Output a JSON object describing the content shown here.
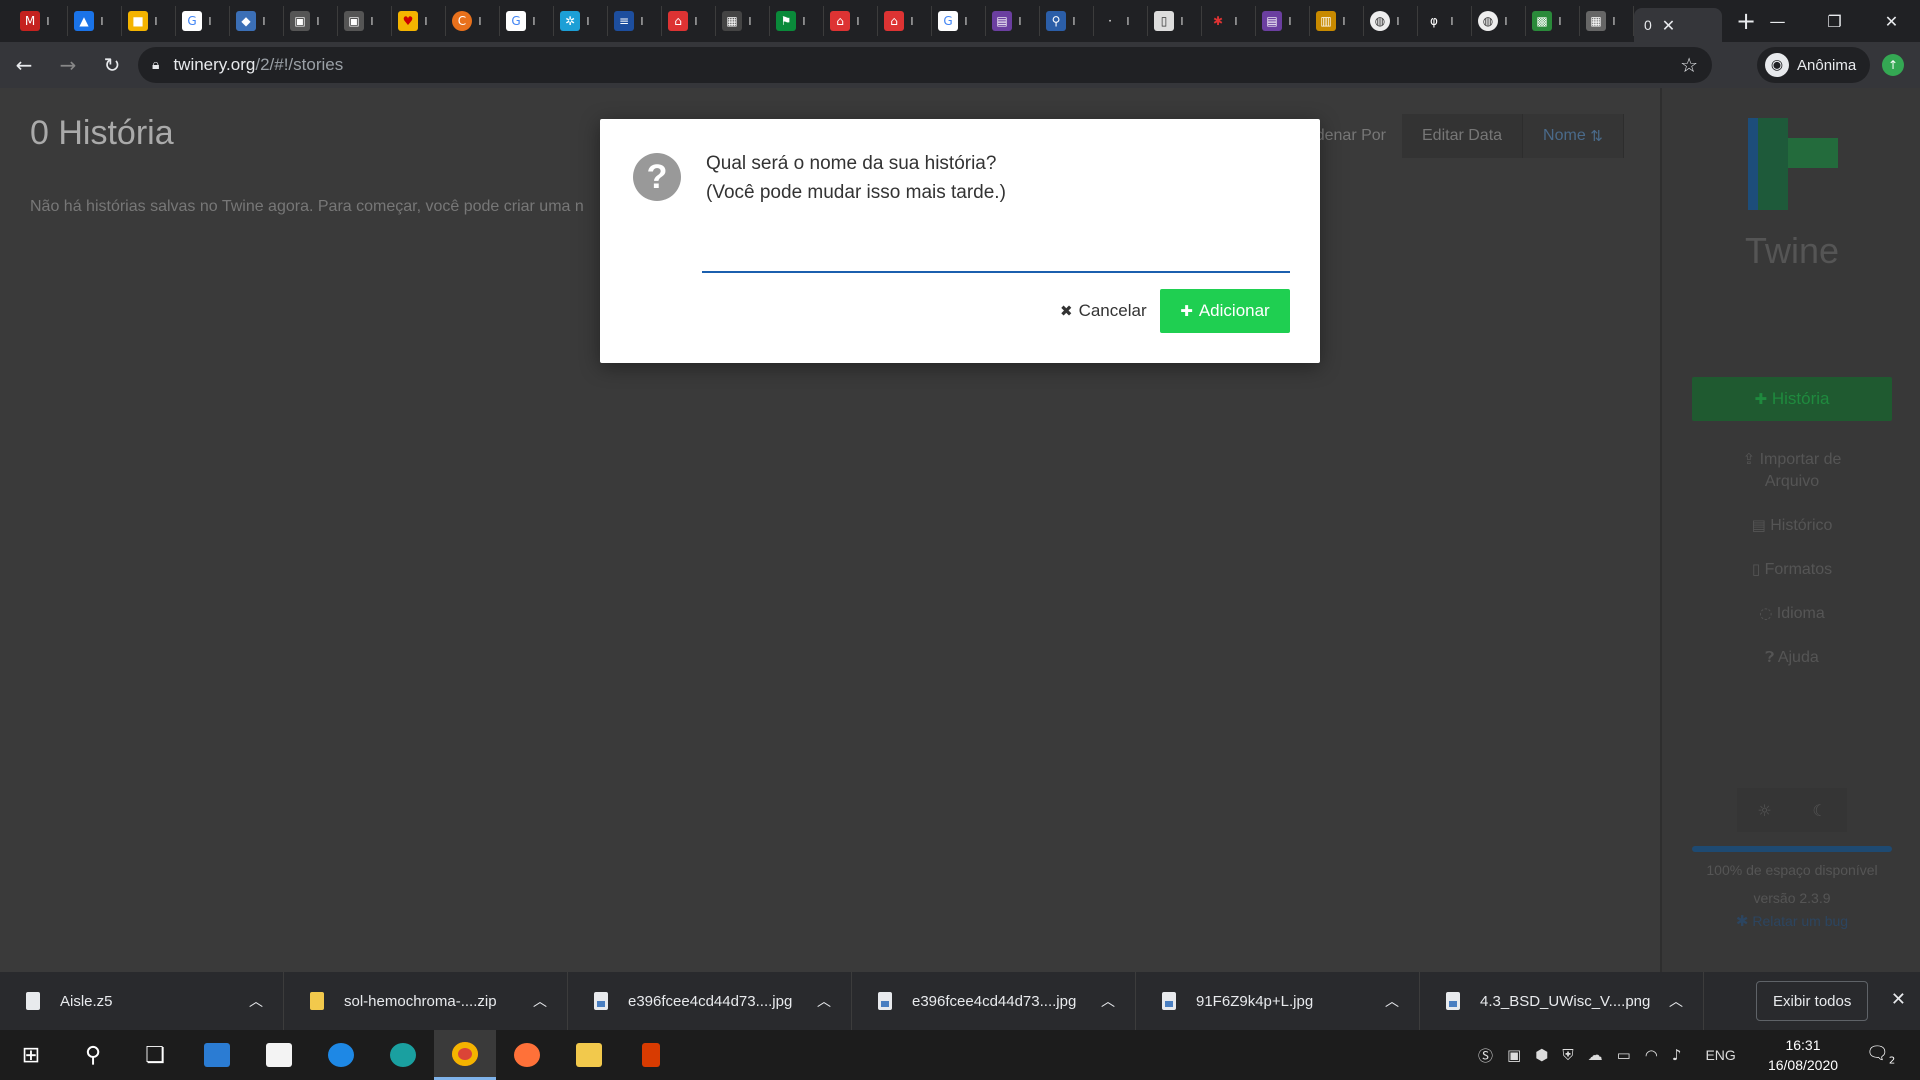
{
  "browser": {
    "tab_titles_visible": [
      "0"
    ],
    "url_host": "twinery.org",
    "url_path": "/2/#!/stories",
    "profile_label": "Anônima"
  },
  "page": {
    "title": "0 História",
    "empty_message": "Não há histórias salvas no Twine agora. Para começar, você pode criar uma n",
    "sort_label": "Ordenar Por",
    "sort_edit_date": "Editar Data",
    "sort_name": "Nome"
  },
  "sidebar": {
    "logo_text": "Twine",
    "new_story": "História",
    "import_line1": "Importar de",
    "import_line2": "Arquivo",
    "archive": "Histórico",
    "formats": "Formatos",
    "language": "Idioma",
    "help": "Ajuda",
    "storage_fraction": 1.0,
    "storage_text": "100% de espaço disponível",
    "version": "versão 2.3.9",
    "report_bug": "Relatar um bug"
  },
  "modal": {
    "prompt_line1": "Qual será o nome da sua história?",
    "prompt_line2": "(Você pode mudar isso mais tarde.)",
    "input_value": "",
    "cancel_label": "Cancelar",
    "add_label": "Adicionar"
  },
  "downloads": {
    "items": [
      {
        "name": "Aisle.z5"
      },
      {
        "name": "sol-hemochroma-....zip"
      },
      {
        "name": "e396fcee4cd44d73....jpg"
      },
      {
        "name": "e396fcee4cd44d73....jpg"
      },
      {
        "name": "91F6Z9k4p+L.jpg"
      },
      {
        "name": "4.3_BSD_UWisc_V....png"
      }
    ],
    "show_all": "Exibir todos"
  },
  "taskbar": {
    "language": "ENG",
    "time": "16:31",
    "date": "16/08/2020",
    "notification_count": "2"
  },
  "colors": {
    "accent_green": "#1fcf51",
    "input_underline": "#1b5fae"
  }
}
